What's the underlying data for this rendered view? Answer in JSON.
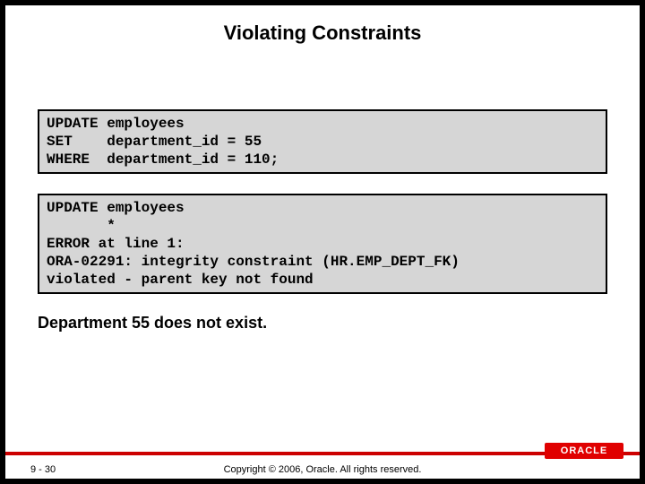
{
  "slide": {
    "title": "Violating Constraints",
    "code_box_1": "UPDATE employees\nSET    department_id = 55\nWHERE  department_id = 110;",
    "code_box_2": "UPDATE employees\n       *\nERROR at line 1:\nORA-02291: integrity constraint (HR.EMP_DEPT_FK)\nviolated - parent key not found",
    "caption": "Department 55 does not exist."
  },
  "footer": {
    "page": "9 - 30",
    "copyright": "Copyright © 2006, Oracle. All rights reserved.",
    "logo_text": "ORACLE"
  }
}
